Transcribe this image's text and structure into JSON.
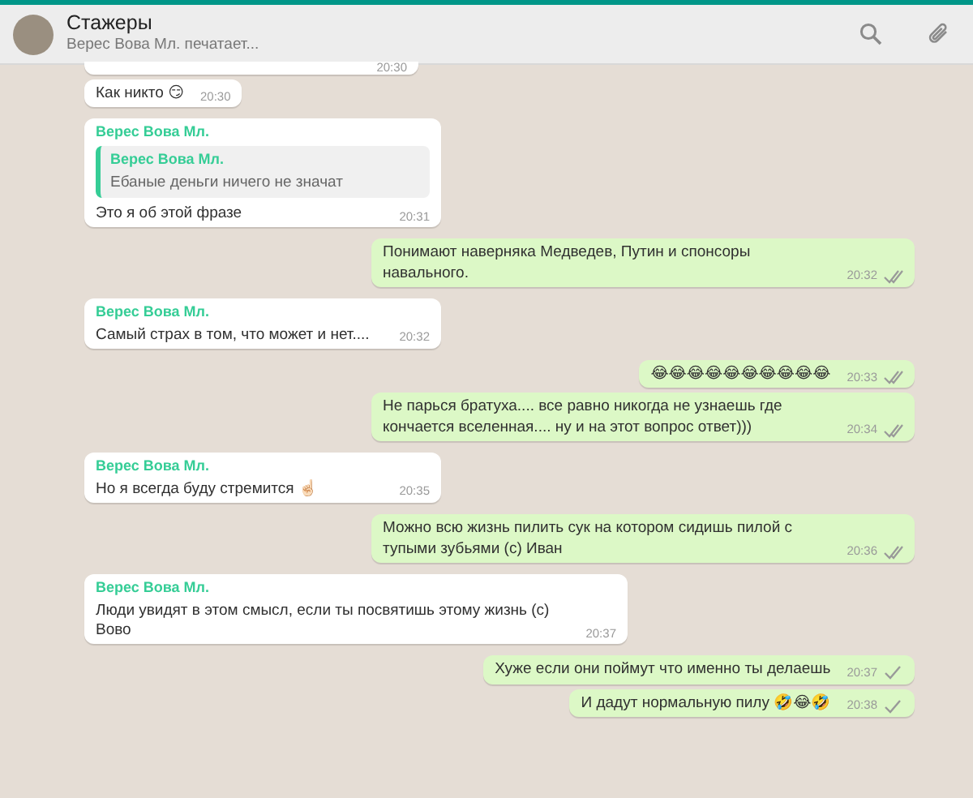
{
  "header": {
    "title": "Стажеры",
    "subtitle": "Верес Вова Мл. печатает..."
  },
  "messages": [
    {
      "kind": "in",
      "time": "20:30"
    },
    {
      "kind": "in",
      "text": "Как никто 😏",
      "time": "20:30"
    },
    {
      "kind": "in",
      "sender": "Верес Вова Мл.",
      "quote": {
        "sender": "Верес Вова Мл.",
        "text": "Ебаные деньги ничего не значат"
      },
      "text": "Это я об этой фразе",
      "time": "20:31"
    },
    {
      "kind": "out",
      "text": "Понимают наверняка Медведев, Путин и спонсоры навального.",
      "time": "20:32",
      "delivered": true
    },
    {
      "kind": "in",
      "sender": "Верес Вова Мл.",
      "text": "Самый страх в том, что может и нет....",
      "time": "20:32"
    },
    {
      "kind": "out",
      "text": "😂😂😂😂😂😂😂😂😂😂",
      "time": "20:33",
      "delivered": true
    },
    {
      "kind": "out",
      "text": "Не парься братуха.... все равно никогда не узнаешь где кончается вселенная.... ну и на этот вопрос ответ)))",
      "time": "20:34",
      "delivered": true
    },
    {
      "kind": "in",
      "sender": "Верес Вова Мл.",
      "text": "Но я всегда буду стремится ☝🏻",
      "time": "20:35"
    },
    {
      "kind": "out",
      "text": "Можно всю жизнь пилить сук на котором сидишь пилой с тупыми зубьями (с) Иван",
      "time": "20:36",
      "delivered": true
    },
    {
      "kind": "in",
      "sender": "Верес Вова Мл.",
      "text": "Люди увидят в этом смысл, если ты посвятишь этому жизнь (с) Вово",
      "time": "20:37"
    },
    {
      "kind": "out",
      "text": "Хуже если они поймут что именно ты делаешь",
      "time": "20:37",
      "delivered": false
    },
    {
      "kind": "out",
      "text": "И дадут нормальную пилу 🤣😂🤣",
      "time": "20:38",
      "delivered": false
    }
  ]
}
